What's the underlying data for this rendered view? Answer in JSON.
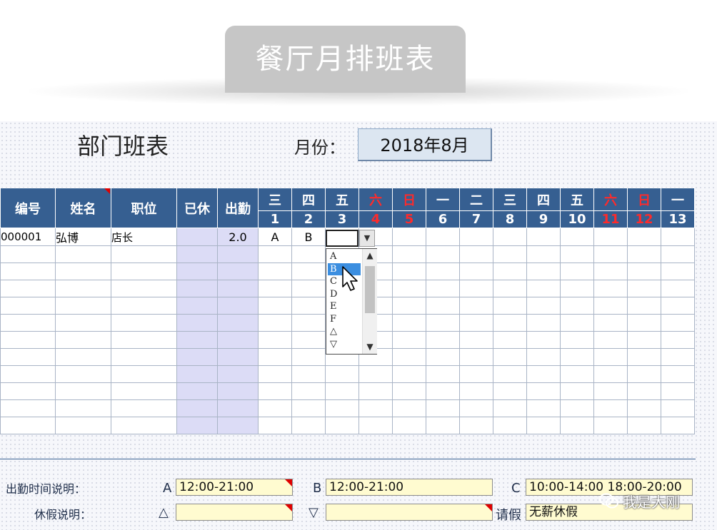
{
  "banner": {
    "title": "餐厅月排班表"
  },
  "sheet": {
    "dept_title": "部门班表",
    "month_label": "月份：",
    "month_value": "2018年8月"
  },
  "columns": {
    "id": "编号",
    "name": "姓名",
    "position": "职位",
    "rested": "已休",
    "attendance": "出勤"
  },
  "days": [
    {
      "weekday": "三",
      "day": "1",
      "weekend": false
    },
    {
      "weekday": "四",
      "day": "2",
      "weekend": false
    },
    {
      "weekday": "五",
      "day": "3",
      "weekend": false
    },
    {
      "weekday": "六",
      "day": "4",
      "weekend": true
    },
    {
      "weekday": "日",
      "day": "5",
      "weekend": true
    },
    {
      "weekday": "一",
      "day": "6",
      "weekend": false
    },
    {
      "weekday": "二",
      "day": "7",
      "weekend": false
    },
    {
      "weekday": "三",
      "day": "8",
      "weekend": false
    },
    {
      "weekday": "四",
      "day": "9",
      "weekend": false
    },
    {
      "weekday": "五",
      "day": "10",
      "weekend": false
    },
    {
      "weekday": "六",
      "day": "11",
      "weekend": true
    },
    {
      "weekday": "日",
      "day": "12",
      "weekend": true
    },
    {
      "weekday": "一",
      "day": "13",
      "weekend": false
    }
  ],
  "employees": [
    {
      "id": "000001",
      "name": "弘博",
      "position": "店长",
      "rested": "",
      "attendance": "2.0",
      "shifts": [
        "A",
        "B",
        "",
        "",
        "",
        "",
        "",
        "",
        "",
        "",
        "",
        "",
        ""
      ]
    }
  ],
  "empty_rows": 11,
  "dropdown": {
    "options": [
      "A",
      "B",
      "C",
      "D",
      "E",
      "F",
      "△",
      "▽"
    ],
    "selected": "B",
    "scroll_up": "▲",
    "scroll_down": "▼",
    "button": "▼"
  },
  "legend": {
    "shift_label": "出勤时间说明：",
    "leave_label": "休假说明：",
    "shifts": [
      {
        "key": "A",
        "value": "12:00-21:00"
      },
      {
        "key": "B",
        "value": "12:00-21:00"
      },
      {
        "key": "C",
        "value": "10:00-14:00  18:00-20:00"
      }
    ],
    "leaves": [
      {
        "key": "△",
        "value": ""
      },
      {
        "key": "▽",
        "value": ""
      },
      {
        "key": "请假",
        "value": "无薪休假"
      }
    ]
  },
  "watermark": "我是大刚",
  "colors": {
    "header_bg": "#365f91",
    "weekend_text": "#ff2a2a",
    "legend_bg": "#fffbd0",
    "rest_col_bg": "#dcdcf6"
  }
}
